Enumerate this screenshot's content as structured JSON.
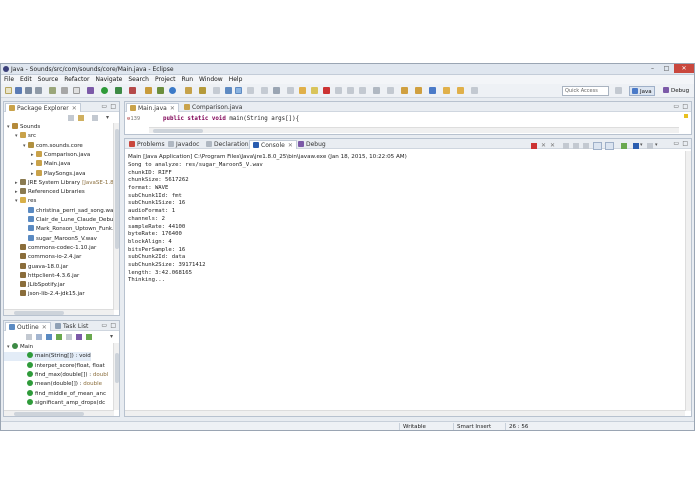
{
  "window": {
    "title": "Java - Sounds/src/com/sounds/core/Main.java - Eclipse"
  },
  "menu": [
    "File",
    "Edit",
    "Source",
    "Refactor",
    "Navigate",
    "Search",
    "Project",
    "Run",
    "Window",
    "Help"
  ],
  "toolbar": {
    "quick_access_placeholder": "Quick Access",
    "perspective_java": "Java",
    "perspective_debug": "Debug"
  },
  "package_explorer": {
    "tab_label": "Package Explorer",
    "tree": [
      {
        "label": "Sounds",
        "depth": 0,
        "twisty": "▾",
        "icon": "project-icon"
      },
      {
        "label": "src",
        "depth": 1,
        "twisty": "▾",
        "icon": "source-folder-icon"
      },
      {
        "label": "com.sounds.core",
        "depth": 2,
        "twisty": "▾",
        "icon": "package-icon"
      },
      {
        "label": "Comparison.java",
        "depth": 3,
        "twisty": "▸",
        "icon": "java-file-icon"
      },
      {
        "label": "Main.java",
        "depth": 3,
        "twisty": "▸",
        "icon": "java-file-icon"
      },
      {
        "label": "PlaySongs.java",
        "depth": 3,
        "twisty": "▸",
        "icon": "java-file-icon"
      },
      {
        "label": "JRE System Library",
        "suffix": "[JavaSE-1.8]",
        "depth": 1,
        "twisty": "▸",
        "icon": "library-icon"
      },
      {
        "label": "Referenced Libraries",
        "depth": 1,
        "twisty": "▸",
        "icon": "library-icon"
      },
      {
        "label": "res",
        "depth": 1,
        "twisty": "▾",
        "icon": "folder-icon"
      },
      {
        "label": "christina_perri_sad_song.wav",
        "depth": 2,
        "twisty": "",
        "icon": "file-icon"
      },
      {
        "label": "Clair_de_Lune_Claude_Debussy.wav",
        "depth": 2,
        "twisty": "",
        "icon": "file-icon"
      },
      {
        "label": "Mark_Ronson_Uptown_Funk.wav",
        "depth": 2,
        "twisty": "",
        "icon": "file-icon"
      },
      {
        "label": "sugar_Maroon5_V.wav",
        "depth": 2,
        "twisty": "",
        "icon": "file-icon"
      },
      {
        "label": "commons-codec-1.10.jar",
        "depth": 1,
        "twisty": "",
        "icon": "jar-icon"
      },
      {
        "label": "commons-io-2.4.jar",
        "depth": 1,
        "twisty": "",
        "icon": "jar-icon"
      },
      {
        "label": "guava-18.0.jar",
        "depth": 1,
        "twisty": "",
        "icon": "jar-icon"
      },
      {
        "label": "httpclient-4.3.6.jar",
        "depth": 1,
        "twisty": "",
        "icon": "jar-icon"
      },
      {
        "label": "JLibSpotify.jar",
        "depth": 1,
        "twisty": "",
        "icon": "jar-icon"
      },
      {
        "label": "json-lib-2.4-jdk15.jar",
        "depth": 1,
        "twisty": "",
        "icon": "jar-icon"
      }
    ]
  },
  "outline": {
    "tabs": [
      "Outline",
      "Task List"
    ],
    "items": [
      {
        "label": "Main",
        "type": "",
        "depth": 0,
        "icon": "class-icon"
      },
      {
        "label": "main(String[]) : void",
        "type": "",
        "depth": 1,
        "icon": "method-icon"
      },
      {
        "label": "interpet_score(float, float",
        "type": "",
        "depth": 1,
        "icon": "method-icon"
      },
      {
        "label": "find_max(double[]) : ",
        "type": "doubl",
        "depth": 1,
        "icon": "method-icon"
      },
      {
        "label": "mean(double[]) : ",
        "type": "double",
        "depth": 1,
        "icon": "method-icon"
      },
      {
        "label": "find_middle_of_mean_anc",
        "type": "",
        "depth": 1,
        "icon": "method-icon"
      },
      {
        "label": "significant_amp_drops(dc",
        "type": "",
        "depth": 1,
        "icon": "method-icon"
      }
    ]
  },
  "editor": {
    "tabs": [
      "Main.java",
      "Comparison.java"
    ],
    "line_number": "139",
    "code_keywords": "public static void",
    "code_rest": " main(String args[]){"
  },
  "console": {
    "tabs": [
      "Problems",
      "Javadoc",
      "Declaration",
      "Console",
      "Debug"
    ],
    "header": "Main [Java Application] C:\\Program Files\\Java\\jre1.8.0_25\\bin\\javaw.exe (Jan 18, 2015, 10:22:05 AM)",
    "lines": [
      "Song to analyze: res/sugar_Maroon5_V.wav",
      "chunkID: RIFF",
      "chunkSize: 5617262",
      "format: WAVE",
      "subChunk1Id: fmt",
      "subChunk1Size: 16",
      "audioFormat: 1",
      "channels: 2",
      "sampleRate: 44100",
      "byteRate: 176400",
      "blockAlign: 4",
      "bitsPerSample: 16",
      "subChunk2Id: data",
      "subChunk2Size: 39171412",
      "length: 3:42.068165",
      "Thinking..."
    ]
  },
  "status": {
    "writable": "Writable",
    "insert_mode": "Smart Insert",
    "position": "26 : 56"
  },
  "colors": {
    "keyword": "#7f0055",
    "accent": "#2a5db0",
    "suffix": "#8a6d3b"
  }
}
